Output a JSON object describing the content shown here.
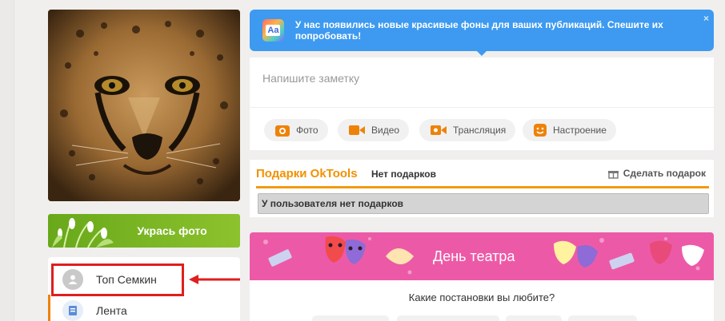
{
  "profile": {
    "photo_alt": "cheetah-photo",
    "decorate_label": "Укрась фото"
  },
  "nav": {
    "profile_name": "Топ Семкин",
    "feed_label": "Лента"
  },
  "tip": {
    "text": "У нас появились новые красивые фоны для ваших публикаций. Спешите их попробовать!",
    "icon_text": "Aa",
    "close": "×"
  },
  "post": {
    "placeholder": "Напишите заметку",
    "actions": [
      {
        "label": "Фото",
        "icon": "camera-icon"
      },
      {
        "label": "Видео",
        "icon": "video-camera-icon"
      },
      {
        "label": "Трансляция",
        "icon": "broadcast-icon"
      },
      {
        "label": "Настроение",
        "icon": "smiley-icon"
      }
    ]
  },
  "gifts": {
    "title": "Подарки OkTools",
    "status": "Нет подарков",
    "make_gift": "Сделать подарок",
    "empty_message": "У пользователя нет подарков"
  },
  "theater": {
    "banner_title": "День театра",
    "question": "Какие постановки вы любите?"
  },
  "colors": {
    "accent_orange": "#f29100",
    "tip_blue": "#3d9af0",
    "decorate_green": "#79b521",
    "theater_pink": "#ec5aa7",
    "highlight_red": "#e01e1e"
  }
}
